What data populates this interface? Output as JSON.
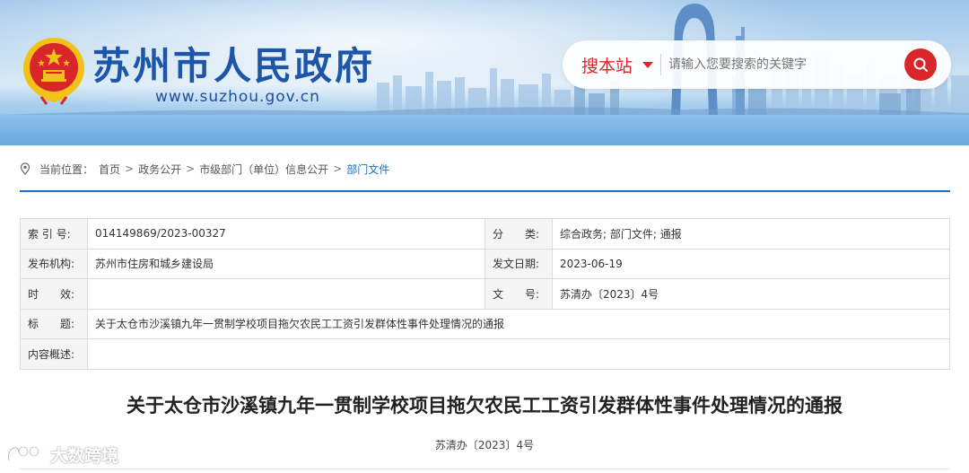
{
  "header": {
    "site_title": "苏州市人民政府",
    "site_domain": "www.suzhou.gov.cn",
    "emblem_icon": "national-emblem",
    "search": {
      "scope_label": "搜本站",
      "placeholder": "请输入您要搜索的关键字",
      "value": "",
      "button_icon": "search-icon",
      "accent_color": "#d8262a"
    }
  },
  "breadcrumb": {
    "prefix": "当前位置：",
    "items": [
      "首页",
      "政务公开",
      "市级部门（单位）信息公开",
      "部门文件"
    ],
    "separator": ">"
  },
  "info_table": {
    "index_label": "索 引 号:",
    "index_value": "014149869/2023-00327",
    "category_label": "分　　类:",
    "category_value": "综合政务;  部门文件;  通报",
    "issuer_label": "发布机构:",
    "issuer_value": "苏州市住房和城乡建设局",
    "date_label": "发文日期:",
    "date_value": "2023-06-19",
    "validity_label": "时　　效:",
    "validity_value": "",
    "docno_label": "文　　号:",
    "docno_value": "苏清办〔2023〕4号",
    "title_label": "标　　题:",
    "title_value": "关于太仓市沙溪镇九年一贯制学校项目拖欠农民工工资引发群体性事件处理情况的通报",
    "summary_label": "内容概述:",
    "summary_value": ""
  },
  "article": {
    "title": "关于太仓市沙溪镇九年一贯制学校项目拖欠农民工工资引发群体性事件处理情况的通报",
    "doc_number": "苏清办〔2023〕4号"
  },
  "watermark": {
    "text": "大数跨境",
    "icon": "brand-logo-icon"
  },
  "colors": {
    "primary_blue": "#1d6fc3",
    "title_blue": "#1d56a8",
    "accent_red": "#d8262a"
  }
}
